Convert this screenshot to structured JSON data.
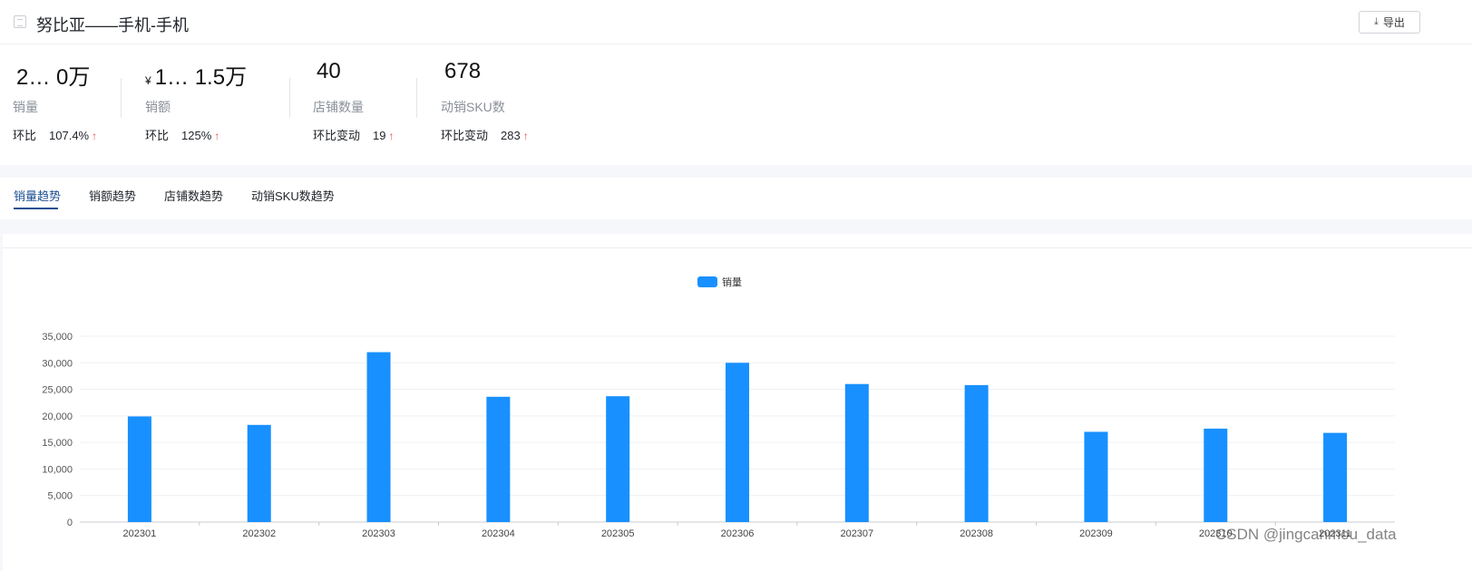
{
  "header": {
    "title": "努比亚——手机-手机",
    "export_label": "导出",
    "export_icon": "download-icon"
  },
  "stats": [
    {
      "value": "2… 0万",
      "currency": "",
      "label": "销量",
      "change_label": "环比",
      "change_value": "107.4%",
      "trend_icon": "arrow-up-icon"
    },
    {
      "value": "1… 1.5万",
      "currency": "¥",
      "label": "销额",
      "change_label": "环比",
      "change_value": "125%",
      "trend_icon": "arrow-up-icon"
    },
    {
      "value": "40",
      "currency": "",
      "label": "店铺数量",
      "change_label": "环比变动",
      "change_value": "19",
      "trend_icon": "arrow-up-icon"
    },
    {
      "value": "678",
      "currency": "",
      "label": "动销SKU数",
      "change_label": "环比变动",
      "change_value": "283",
      "trend_icon": "arrow-up-icon"
    }
  ],
  "tabs": [
    {
      "label": "销量趋势",
      "active": true
    },
    {
      "label": "销额趋势",
      "active": false
    },
    {
      "label": "店铺数趋势",
      "active": false
    },
    {
      "label": "动销SKU数趋势",
      "active": false
    }
  ],
  "colors": {
    "bar": "#1890ff",
    "accent": "#1d4f91",
    "up": "#f0484b"
  },
  "chart_data": {
    "type": "bar",
    "legend": "销量",
    "legend_position": "top-center",
    "grid": true,
    "categories": [
      "202301",
      "202302",
      "202303",
      "202304",
      "202305",
      "202306",
      "202307",
      "202308",
      "202309",
      "202310",
      "202311"
    ],
    "series": [
      {
        "name": "销量",
        "values": [
          19900,
          18300,
          32000,
          23600,
          23700,
          30000,
          26000,
          25800,
          17000,
          17600,
          16800
        ]
      }
    ],
    "yticks": [
      "0",
      "5,000",
      "10,000",
      "15,000",
      "20,000",
      "25,000",
      "30,000",
      "35,000"
    ],
    "ylim": [
      0,
      35000
    ]
  },
  "watermark": "CSDN @jingcanmou_data"
}
